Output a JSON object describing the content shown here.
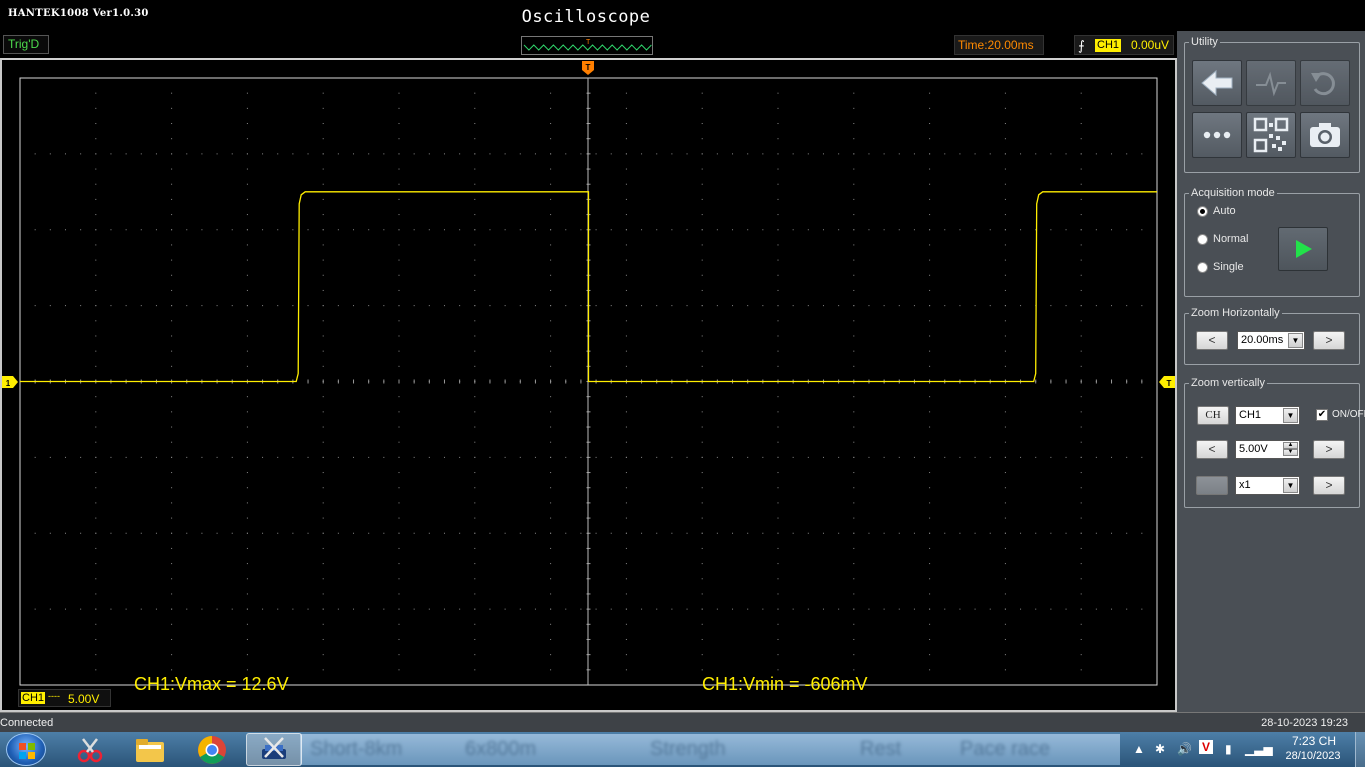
{
  "app": {
    "version": "HANTEK1008 Ver1.0.30",
    "title": "Oscilloscope"
  },
  "status": {
    "trig_state": "Trig'D",
    "mini_marker": "T",
    "time_label": "Time:20.00ms",
    "trig_channel": "CH1",
    "trig_level": "0.00uV"
  },
  "scope": {
    "trigger_marker": "T",
    "ch1_marker": "1",
    "trig_level_marker": "T",
    "measure_vmax": "CH1:Vmax = 12.6V",
    "measure_vmin": "CH1:Vmin = -606mV",
    "channel_tag": "CH1",
    "channel_coupling": "----",
    "channel_scale": "5.00V",
    "trace_color": "#ffee00",
    "high_level_div": 2.5,
    "edges_div": [
      3.67,
      13.4
    ],
    "falling_edge_div": 7.5
  },
  "panel": {
    "utility": {
      "legend": "Utility",
      "buttons": [
        "back",
        "math-wave",
        "undo",
        "more",
        "qr-code",
        "screenshot"
      ]
    },
    "acquisition": {
      "legend": "Acquisition mode",
      "auto": "Auto",
      "normal": "Normal",
      "single": "Single",
      "selected": "Auto"
    },
    "zoom_h": {
      "legend": "Zoom Horizontally",
      "value": "20.00ms",
      "left": "<",
      "right": ">"
    },
    "zoom_v": {
      "legend": "Zoom vertically",
      "ch_button": "CH",
      "channel": "CH1",
      "onoff_label": "ON/OFF",
      "volts": "5.00V",
      "probe": "x1",
      "left": "<",
      "right": ">"
    }
  },
  "footer": {
    "connection": "Connected",
    "datetime": "28-10-2023  19:23"
  },
  "taskbar": {
    "clock_time": "7:23 CH",
    "clock_date": "28/10/2023",
    "blurred_text": [
      "Short-8km",
      "6x800m",
      "Strength",
      "Rest",
      "Pace race"
    ]
  },
  "colors": {
    "trace": "#ffee00",
    "trig_green": "#4ddc4d",
    "time_orange": "#ff8a00",
    "trigger_orange": "#ff7f00",
    "panel_bg": "#4a4f55"
  }
}
